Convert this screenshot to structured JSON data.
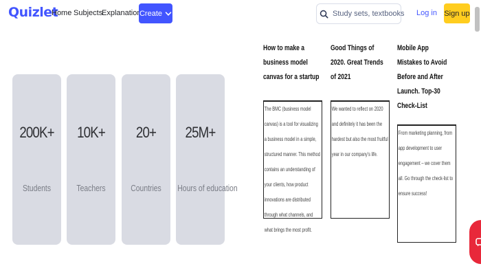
{
  "header": {
    "logo": "Quizlet",
    "nav": {
      "home": "Home",
      "subjects": "Subjects",
      "explanations": "Explanations"
    },
    "create_label": "Create",
    "search_placeholder": "Study sets, textbooks, ...",
    "login_label": "Log in",
    "signup_label": "Sign up"
  },
  "stats": [
    {
      "value": "200K+",
      "label": "Students"
    },
    {
      "value": "10K+",
      "label": "Teachers"
    },
    {
      "value": "20+",
      "label": "Countries"
    },
    {
      "value": "25M+",
      "label": "Hours of education"
    }
  ],
  "articles": [
    {
      "title": "How to make a business model canvas for a startup",
      "body": "The BMC (business model canvas) is a tool for visualizing a business model in a simple, structured manner. This method contains an understanding of your clients, how product innovations are distributed through what channels, and what brings the most profit."
    },
    {
      "title": "Good Things of 2020. Great Trends of 2021",
      "body": "We wanted to reflect on 2020 and definitely it has been the hardest but also the most fruitful year in our company's life."
    },
    {
      "title": "Mobile App Mistakes to Avoid Before and After Launch. Top-30 Check-List",
      "body": "From marketing planning, from app development to user engagement – we cover them all. Go through the check-list to ensure success!"
    }
  ],
  "colors": {
    "brand": "#4255ff",
    "signup": "#ffcd1f",
    "card": "#d9dbe3",
    "chat": "#e8283a"
  },
  "icons": {
    "search": "search-icon",
    "create_chevron": "chevron-down-icon",
    "chat": "chat-icon"
  }
}
